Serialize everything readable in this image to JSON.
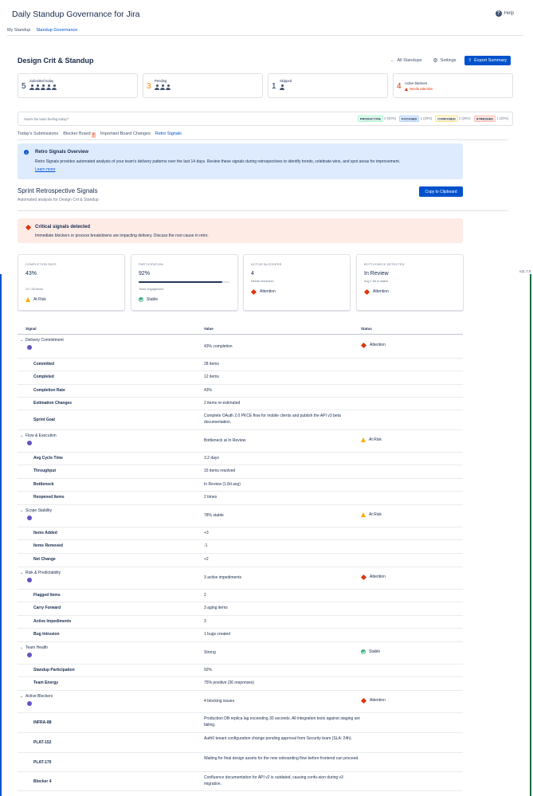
{
  "app": {
    "title": "Daily Standup Governance for Jira",
    "help": "Help",
    "version": "v11.7.0"
  },
  "top_tabs": [
    "My Standup",
    "Standup Governance"
  ],
  "header": {
    "title": "Design Crit & Standup",
    "all_standups": "All Standups",
    "settings": "Settings",
    "export": "Export Summary"
  },
  "stats": {
    "submitted": {
      "num": "5",
      "label": "Submitted today"
    },
    "pending": {
      "num": "3",
      "label": "Pending"
    },
    "skipped": {
      "num": "1",
      "label": "Skipped"
    },
    "blockers": {
      "num": "4",
      "label": "Active blockers",
      "sub": "Needs attention"
    }
  },
  "mood": {
    "question": "How's the team feeling today?",
    "tags": [
      {
        "label": "PRODUCTIVE",
        "count": "2 (40%)",
        "color": "#e3fcef"
      },
      {
        "label": "FOCUSED",
        "count": "1 (20%)",
        "color": "#deebff"
      },
      {
        "label": "CONFUSED",
        "count": "1 (20%)",
        "color": "#fffae6"
      },
      {
        "label": "STRESSED",
        "count": "1 (20%)",
        "color": "#ffebe6"
      }
    ]
  },
  "sub_tabs": {
    "submissions": "Today's Submissions",
    "blocker_board": "Blocker Board",
    "blocker_count": "4",
    "board_changes": "Important Board Changes",
    "retro_signals": "Retro Signals"
  },
  "overview": {
    "title": "Retro Signals Overview",
    "text": "Retro Signals provides automated analysis of your team's delivery patterns over the last 14 days. Review these signals during retrospectives to identify trends, celebrate wins, and spot areas for improvement.",
    "link": "Learn more"
  },
  "sprint": {
    "title": "Sprint Retrospective Signals",
    "subtitle": "Automated analysis for Design Crit & Standup",
    "copy": "Copy to Clipboard"
  },
  "critical": {
    "title": "Critical signals detected",
    "text": "Immediate blockers or process breakdowns are impacting delivery. Discuss the root cause in retro."
  },
  "cards": {
    "completion": {
      "label": "COMPLETION RATE",
      "value": "43%",
      "sub": "12 / 28 items",
      "status": "At Risk"
    },
    "participation": {
      "label": "PARTICIPATION",
      "value": "92%",
      "progress": 0.92,
      "sub": "Team engagement",
      "status": "Stable"
    },
    "blockers": {
      "label": "ACTIVE BLOCKERS",
      "value": "4",
      "sub": "Needs resolution",
      "status": "Attention"
    },
    "bottleneck": {
      "label": "BOTTLENECK DETECTED",
      "value": "In Review",
      "sub": "Avg 1.8d in status",
      "status": "Attention"
    }
  },
  "table": {
    "headers": {
      "signal": "Signal",
      "value": "Value",
      "status": "Status"
    },
    "delivery": {
      "name": "Delivery Commitment",
      "value": "43% completion",
      "status": "Attention",
      "rows": [
        {
          "label": "Committed",
          "value": "28 items"
        },
        {
          "label": "Completed",
          "value": "12 items"
        },
        {
          "label": "Completion Rate",
          "value": "43%"
        },
        {
          "label": "Estimation Changes",
          "value": "2 items re-estimated"
        },
        {
          "label": "Sprint Goal",
          "value": "Complete OAuth 2.0 PKCE flow for mobile clients and publish the API v3 beta documentation."
        }
      ]
    },
    "flow": {
      "name": "Flow & Execution",
      "value": "Bottleneck at In Review",
      "status": "At Risk",
      "rows": [
        {
          "label": "Avg Cycle Time",
          "value": "3.2 days"
        },
        {
          "label": "Throughput",
          "value": "15 items resolved"
        },
        {
          "label": "Bottleneck",
          "value": "In Review (1.8d avg)"
        },
        {
          "label": "Reopened Items",
          "value": "2 times"
        }
      ]
    },
    "scope": {
      "name": "Scope Stability",
      "value": "78% stable",
      "status": "At Risk",
      "rows": [
        {
          "label": "Items Added",
          "value": "+3"
        },
        {
          "label": "Items Removed",
          "value": "-1"
        },
        {
          "label": "Net Change",
          "value": "+2"
        }
      ]
    },
    "risk": {
      "name": "Risk & Predictability",
      "value": "3 active impediments",
      "status": "Attention",
      "rows": [
        {
          "label": "Flagged Items",
          "value": "2"
        },
        {
          "label": "Carry Forward",
          "value": "3 aging items"
        },
        {
          "label": "Active Impediments",
          "value": "3"
        },
        {
          "label": "Bug Intrusion",
          "value": "1 bugs created"
        }
      ]
    },
    "health": {
      "name": "Team Health",
      "value": "Strong",
      "status": "Stable",
      "rows": [
        {
          "label": "Standup Participation",
          "value": "92%"
        },
        {
          "label": "Team Energy",
          "value": "75% positive (36 responses)"
        }
      ]
    },
    "blockers": {
      "name": "Active Blockers",
      "value": "4 blocking issues",
      "status": "Attention",
      "rows": [
        {
          "label": "INFRA-88",
          "value": "Production DB replica lag exceeding 30 seconds. All integration tests against staging are failing."
        },
        {
          "label": "PLAT-152",
          "value": "Auth0 tenant configuration change pending approval from Security team (SLA: 24h)."
        },
        {
          "label": "PLAT-170",
          "value": "Waiting for final design assets for the new onboarding flow before frontend can proceed."
        },
        {
          "label": "Blocker 4",
          "value": "Confluence documentation for API v2 is outdated, causing confu-sion during v3 migration."
        }
      ]
    }
  }
}
